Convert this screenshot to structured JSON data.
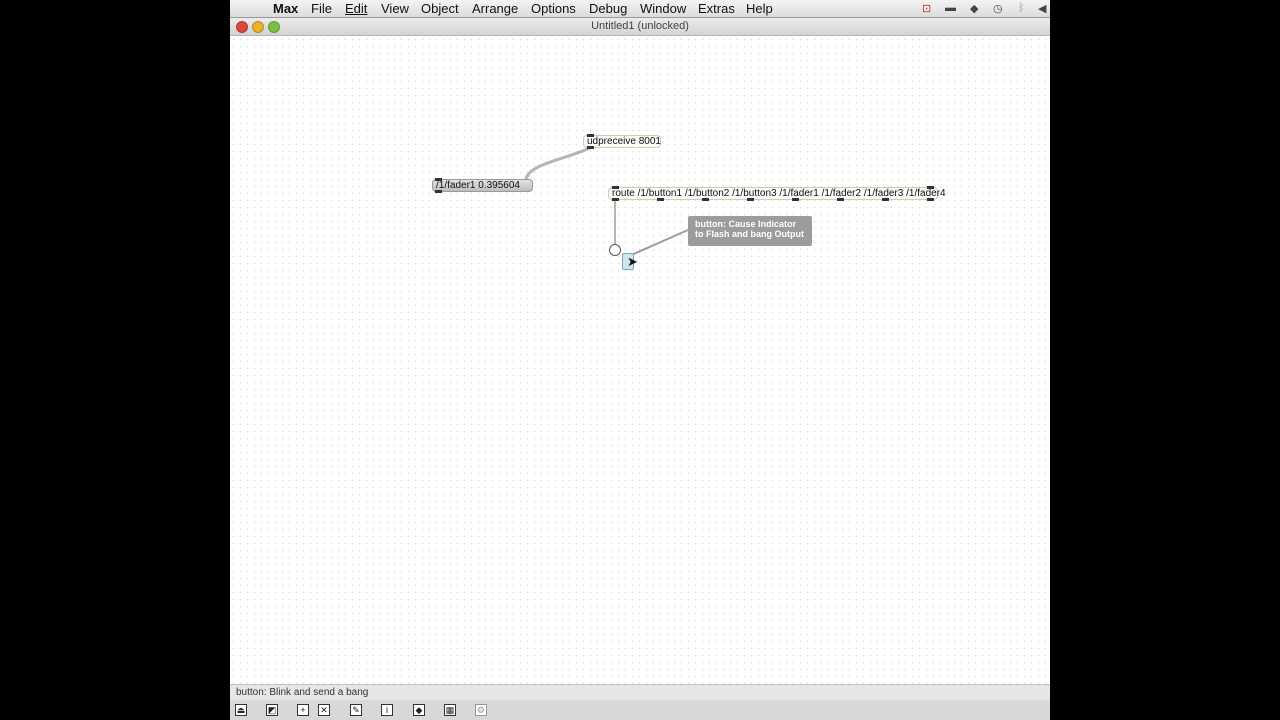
{
  "menubar": {
    "items": [
      "Max",
      "File",
      "Edit",
      "View",
      "Object",
      "Arrange",
      "Options",
      "Debug",
      "Window",
      "Extras",
      "Help"
    ]
  },
  "window": {
    "title": "Untitled1 (unlocked)"
  },
  "patch": {
    "udpreceive": "udpreceive 8001",
    "message": "/1/fader1 0.395604",
    "route": "route /1/button1 /1/button2 /1/button3 /1/fader1 /1/fader2 /1/fader3 /1/fader4",
    "hint_line1": "button: Cause Indicator",
    "hint_line2": "to Flash and bang Output"
  },
  "status": {
    "text": "button: Blink and send a bang"
  },
  "colors": {
    "cord": "#b4b4b4",
    "box_border": "#c9d2a8",
    "hint_bg": "#9c9c9c"
  },
  "toolbar_icons": [
    "lock-icon",
    "presentation-icon",
    "new-object-icon",
    "close-object-icon",
    "edit-icon",
    "inspector-icon",
    "autocomplete-icon",
    "grid-icon",
    "snap-icon"
  ]
}
